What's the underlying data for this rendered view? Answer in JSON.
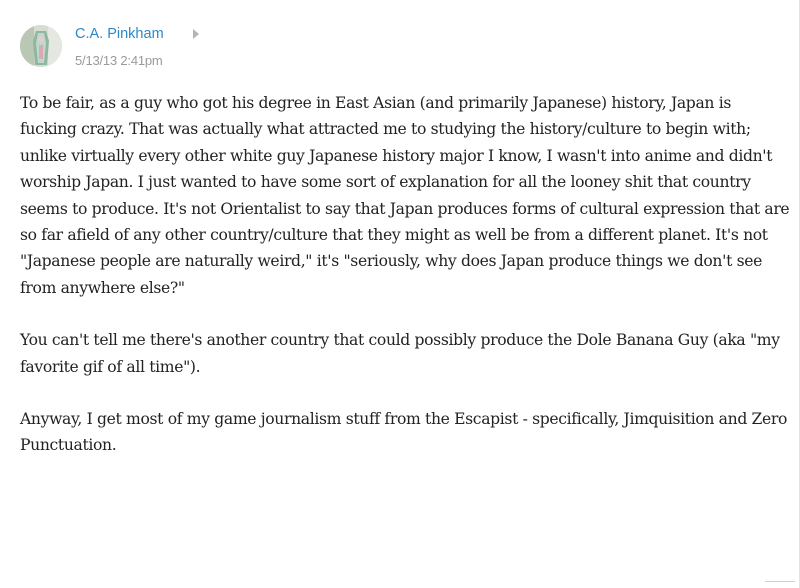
{
  "comment": {
    "author": "C.A. Pinkham",
    "timestamp": "5/13/13 2:41pm",
    "paragraphs": [
      "To be fair, as a guy who got his degree in East Asian (and primarily Japanese) history, Japan is fucking crazy. That was actually what attracted me to studying the history/culture to begin with; unlike virtually every other white guy Japanese history major I know, I wasn't into anime and didn't worship Japan. I just wanted to have some sort of explanation for all the looney shit that country seems to produce. It's not Orientalist to say that Japan produces forms of cultural expression that are so far afield of any other country/culture that they might as well be from a different planet. It's not \"Japanese people are naturally weird,\" it's \"seriously, why does Japan produce things we don't see from anywhere else?\"",
      "You can't tell me there's another country that could possibly produce the Dole Banana Guy (aka \"my favorite gif of all time\").",
      "Anyway, I get most of my game journalism stuff from the Escapist - specifically, Jimquisition and Zero Punctuation."
    ]
  },
  "colors": {
    "author_link": "#2b88c9",
    "timestamp": "#9a9a9a",
    "body_text": "#222222"
  },
  "icons": {
    "reply_caret": "caret-right-icon"
  }
}
